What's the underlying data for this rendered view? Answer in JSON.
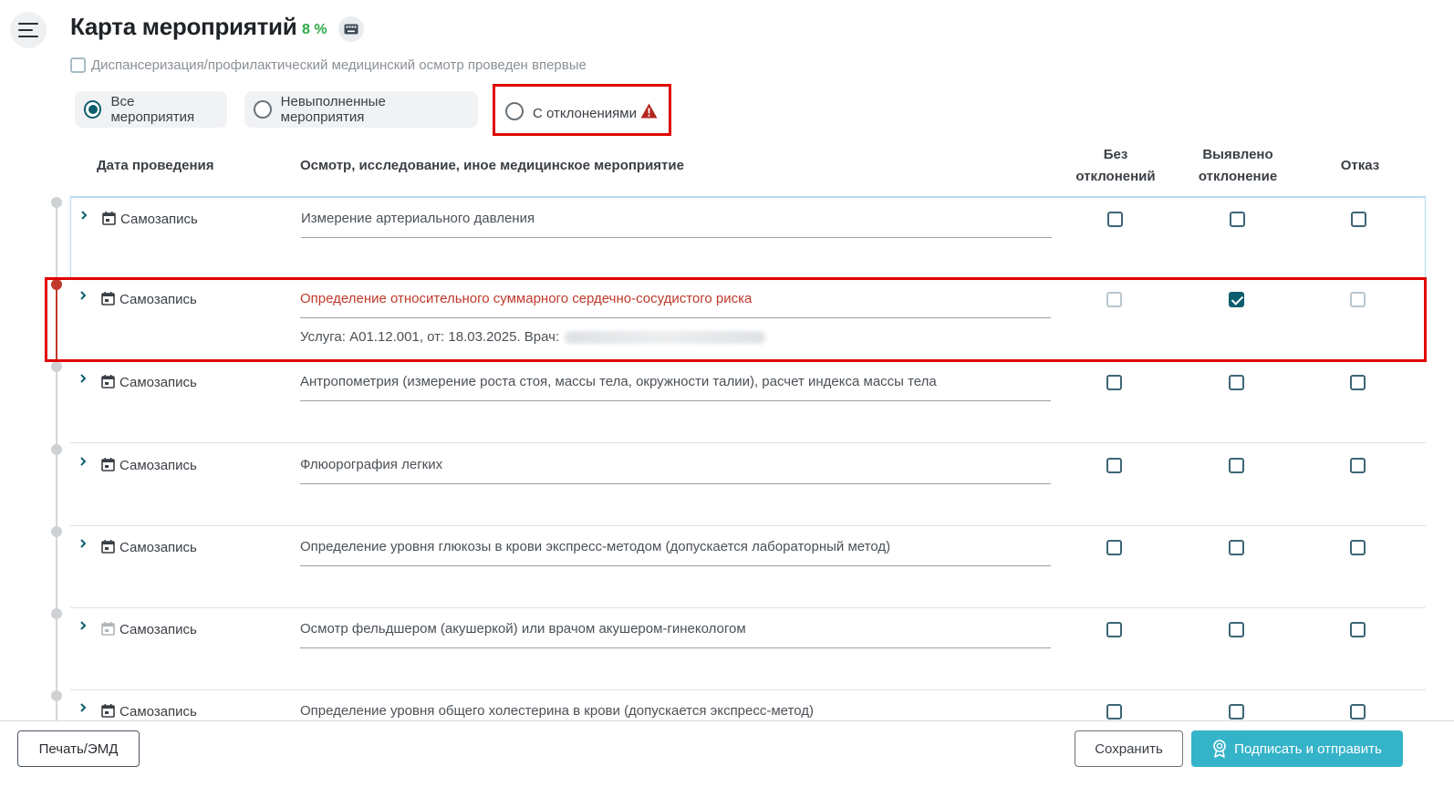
{
  "header": {
    "title": "Карта мероприятий",
    "percent": "8 %",
    "first_time_label": "Диспансеризация/профилактический медицинский осмотр проведен впервые"
  },
  "filters": [
    {
      "label": "Все мероприятия",
      "selected": true
    },
    {
      "label": "Невыполненные мероприятия",
      "selected": false
    },
    {
      "label": "С отклонениями",
      "selected": false
    }
  ],
  "columns": {
    "date": "Дата проведения",
    "event": "Осмотр, исследование, иное медицинское мероприятие",
    "no_dev_1": "Без",
    "no_dev_2": "отклонений",
    "dev_1": "Выявлено",
    "dev_2": "отклонение",
    "refusal": "Отказ"
  },
  "rows": [
    {
      "record": "Самозапись",
      "name": "Измерение артериального давления",
      "checks": [
        false,
        false,
        false
      ]
    },
    {
      "record": "Самозапись",
      "name": "Определение относительного суммарного сердечно-сосудистого риска",
      "detail": "Услуга: A01.12.001, от: 18.03.2025. Врач:",
      "checks": [
        false,
        true,
        false
      ]
    },
    {
      "record": "Самозапись",
      "name": "Антропометрия (измерение роста стоя, массы тела, окружности талии), расчет индекса массы тела",
      "checks": [
        false,
        false,
        false
      ]
    },
    {
      "record": "Самозапись",
      "name": "Флюорография легких",
      "checks": [
        false,
        false,
        false
      ]
    },
    {
      "record": "Самозапись",
      "name": "Определение уровня глюкозы в крови экспресс-методом (допускается лабораторный метод)",
      "checks": [
        false,
        false,
        false
      ]
    },
    {
      "record": "Самозапись",
      "name": "Осмотр фельдшером (акушеркой) или врачом акушером-гинекологом",
      "checks": [
        false,
        false,
        false
      ]
    },
    {
      "record": "Самозапись",
      "name": "Определение уровня общего холестерина в крови (допускается экспресс-метод)",
      "checks": [
        false,
        false,
        false
      ]
    }
  ],
  "footer": {
    "print_label": "Печать/ЭМД",
    "save_label": "Сохранить",
    "sign_label": "Подписать и отправить"
  },
  "colors": {
    "accent": "#0c5e6e",
    "deviation": "#c0392b",
    "percent": "#2eaa4a",
    "sign_button": "#35b3c9",
    "highlight": "#e00000"
  }
}
